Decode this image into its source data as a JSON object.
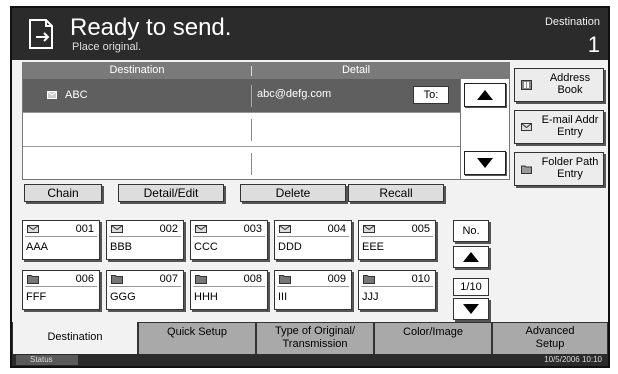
{
  "header": {
    "title": "Ready to send.",
    "subtitle": "Place original.",
    "destination_label": "Destination",
    "destination_count": "1"
  },
  "list": {
    "col_destination": "Destination",
    "col_detail": "Detail",
    "rows": [
      {
        "name": "ABC",
        "detail": "abc@defg.com",
        "type_label": "To:"
      }
    ]
  },
  "actions": {
    "chain": "Chain",
    "detail_edit": "Detail/Edit",
    "delete": "Delete",
    "recall": "Recall"
  },
  "side": {
    "address_book": "Address Book",
    "email_entry": "E-mail Addr Entry",
    "folder_entry": "Folder Path Entry"
  },
  "onetouch": [
    {
      "num": "001",
      "name": "AAA",
      "type": "email"
    },
    {
      "num": "002",
      "name": "BBB",
      "type": "email"
    },
    {
      "num": "003",
      "name": "CCC",
      "type": "email"
    },
    {
      "num": "004",
      "name": "DDD",
      "type": "email"
    },
    {
      "num": "005",
      "name": "EEE",
      "type": "email"
    },
    {
      "num": "006",
      "name": "FFF",
      "type": "folder"
    },
    {
      "num": "007",
      "name": "GGG",
      "type": "folder"
    },
    {
      "num": "008",
      "name": "HHH",
      "type": "folder"
    },
    {
      "num": "009",
      "name": "III",
      "type": "folder"
    },
    {
      "num": "010",
      "name": "JJJ",
      "type": "folder"
    }
  ],
  "paging": {
    "no_label": "No.",
    "page": "1/10"
  },
  "tabs": {
    "destination": "Destination",
    "quick_setup": "Quick Setup",
    "type_original_1": "Type of Original/",
    "type_original_2": "Transmission",
    "color_image": "Color/Image",
    "advanced_1": "Advanced",
    "advanced_2": "Setup"
  },
  "status": {
    "status_label": "Status",
    "datetime": "10/5/2006   10:10"
  }
}
